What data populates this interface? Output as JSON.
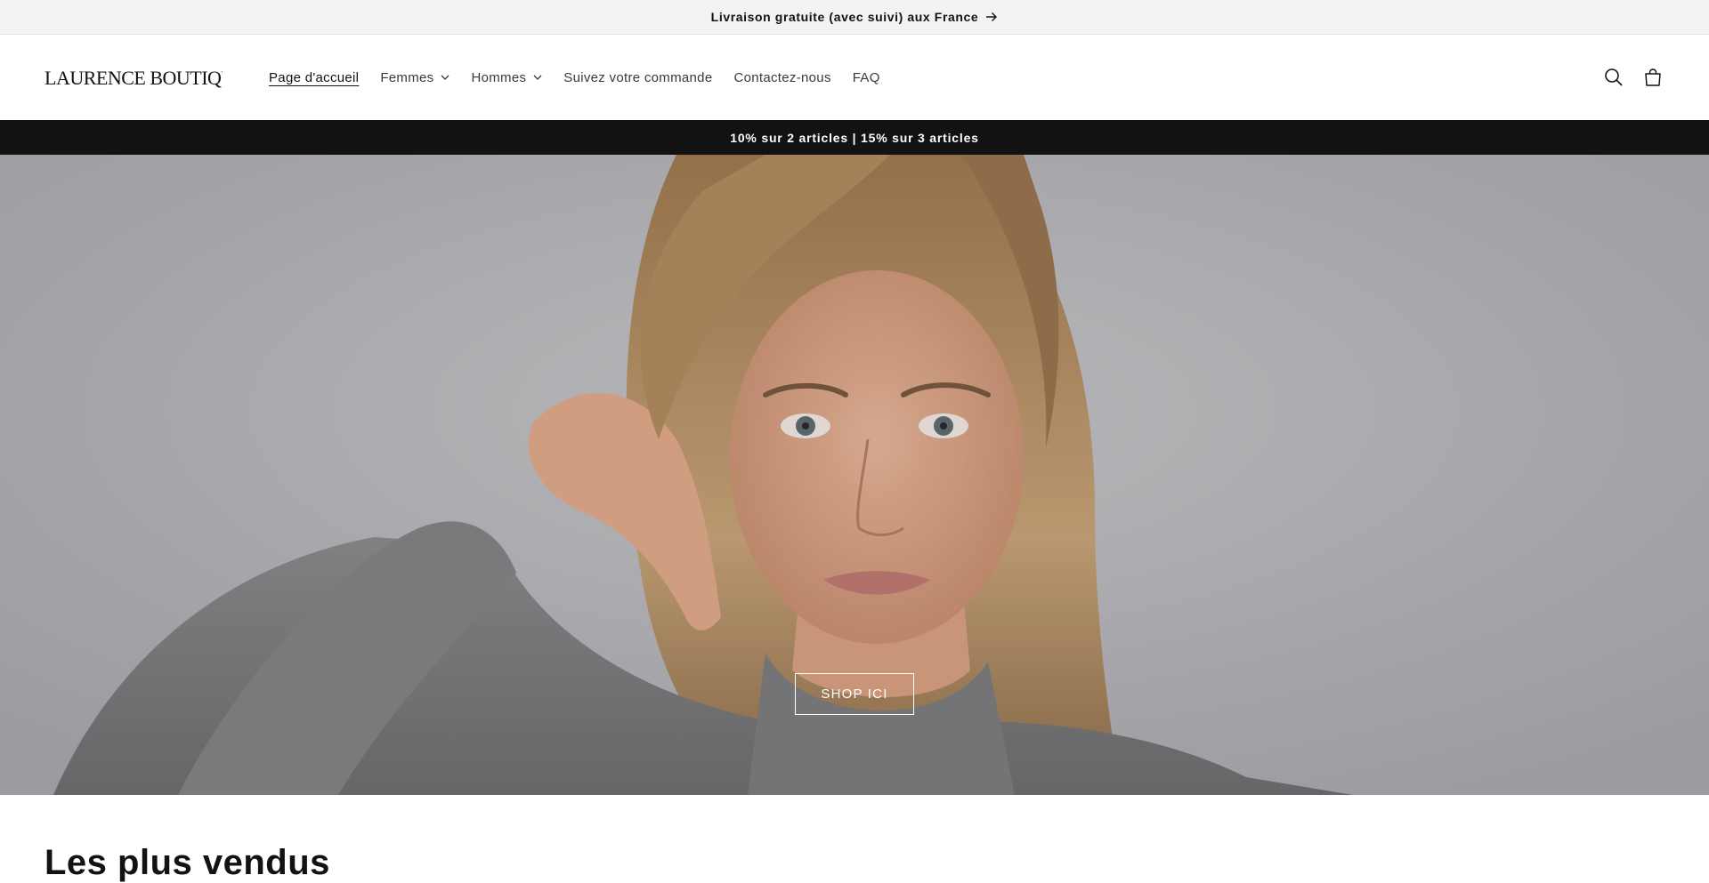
{
  "announcement": {
    "text": "Livraison gratuite (avec suivi) aux France",
    "icon": "arrow-right-icon"
  },
  "header": {
    "logo_text": "LAURENCE BOUTIQUE",
    "nav": [
      {
        "label": "Page d'accueil",
        "active": true,
        "dropdown": false
      },
      {
        "label": "Femmes",
        "active": false,
        "dropdown": true
      },
      {
        "label": "Hommes",
        "active": false,
        "dropdown": true
      },
      {
        "label": "Suivez votre commande",
        "active": false,
        "dropdown": false
      },
      {
        "label": "Contactez-nous",
        "active": false,
        "dropdown": false
      },
      {
        "label": "FAQ",
        "active": false,
        "dropdown": false
      }
    ],
    "icons": [
      "search-icon",
      "cart-icon"
    ]
  },
  "promo": {
    "text": "10% sur 2 articles | 15% sur 3 articles"
  },
  "hero": {
    "button_label": "SHOP ICI"
  },
  "section": {
    "title": "Les plus vendus"
  },
  "colors": {
    "announcement_bg": "#f3f3f3",
    "promo_bg": "#121212",
    "text": "#121212",
    "hero_bg": "#b9b9bd"
  }
}
